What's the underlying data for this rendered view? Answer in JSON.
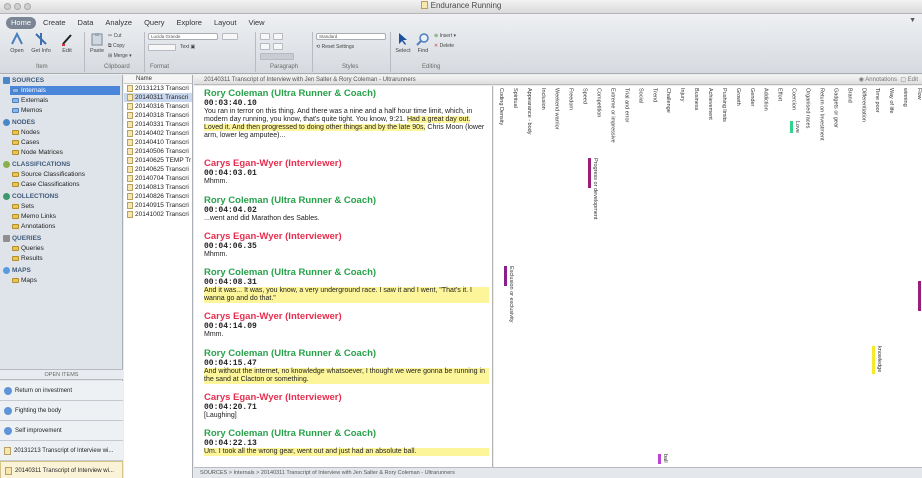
{
  "window": {
    "title": "Endurance Running"
  },
  "ribbon": {
    "tabs": [
      "Home",
      "Create",
      "Data",
      "Analyze",
      "Query",
      "Explore",
      "Layout",
      "View"
    ],
    "active_tab": "Home",
    "groups": [
      "Item",
      "Clipboard",
      "Format",
      "Paragraph",
      "Styles",
      "Editing"
    ],
    "buttons": {
      "open": "Open",
      "get_info": "Get Info",
      "edit": "Edit",
      "paste": "Paste",
      "cut": "Cut",
      "copy": "Copy",
      "merge": "Merge",
      "select": "Select",
      "find": "Find",
      "insert": "Insert",
      "delete": "Delete",
      "reset_settings": "Reset Settings",
      "text": "Text"
    },
    "font_field": "Lucida Grande",
    "style_field": "Standard"
  },
  "nav": {
    "sources": {
      "title": "SOURCES",
      "items": [
        "Internals",
        "Externals",
        "Memos"
      ]
    },
    "nodes": {
      "title": "NODES",
      "items": [
        "Nodes",
        "Cases",
        "Node Matrices"
      ]
    },
    "classifications": {
      "title": "CLASSIFICATIONS",
      "items": [
        "Source Classifications",
        "Case Classifications"
      ]
    },
    "collections": {
      "title": "COLLECTIONS",
      "items": [
        "Sets",
        "Memo Links",
        "Annotations"
      ]
    },
    "queries": {
      "title": "QUERIES",
      "items": [
        "Queries",
        "Results"
      ]
    },
    "maps": {
      "title": "MAPS",
      "items": [
        "Maps"
      ]
    },
    "open_items_title": "OPEN ITEMS",
    "open_items": [
      "Return on investment",
      "Fighting the body",
      "Self improvement",
      "20131213 Transcript of Interview wi...",
      "20140311 Transcript of Interview wi..."
    ]
  },
  "list": {
    "header": "Name",
    "rows": [
      "20131213 Transcri",
      "20140311 Transcri",
      "20140316 Transcri",
      "20140318 Transcri",
      "20140331 Transcri",
      "20140402 Transcri",
      "20140410 Transcri",
      "20140506 Transcri",
      "20140625 TEMP Tr",
      "20140625 Transcri",
      "20140704 Transcri",
      "20140813 Transcri",
      "20140826 Transcri",
      "20140915 Transcri",
      "20141002 Transcri"
    ],
    "selected_index": 1
  },
  "detail": {
    "tab_title": "20140311 Transcript of Interview with Jen Salter & Rory Coleman - Ultrarunners",
    "annotations_label": "Annotations",
    "edit_label": "Edit",
    "entries": [
      {
        "speaker": "Rory Coleman (Ultra Runner & Coach)",
        "time": "00:03:40.10",
        "text": "You ran in terror on this thing. And there was a nine and a half hour time limit, which, in modern day running, you know, that's quite tight. You know, 9:21.",
        "highlight": "Had a great day out. Loved it. And then progressed to doing other things and by the late 90s,",
        "after": "Chris Moon (lower arm, lower leg amputee)..."
      },
      {
        "speaker": "Carys Egan-Wyer (Interviewer)",
        "time": "00:04:03.01",
        "text": "Mhmm."
      },
      {
        "speaker": "Rory Coleman (Ultra Runner & Coach)",
        "time": "00:04:04.02",
        "text": "...went and did Marathon des Sables."
      },
      {
        "speaker": "Carys Egan-Wyer (Interviewer)",
        "time": "00:04:06.35",
        "text": "Mhmm."
      },
      {
        "speaker": "Rory Coleman (Ultra Runner & Coach)",
        "time": "00:04:08.31",
        "text": "And it was... It was, you know, a very underground race. I saw it and I went, \"That's it. I wanna go and do that.\""
      },
      {
        "speaker": "Carys Egan-Wyer (Interviewer)",
        "time": "00:04:14.09",
        "text": "Mmm."
      },
      {
        "speaker": "Rory Coleman (Ultra Runner & Coach)",
        "time": "00:04:15.47",
        "text": "And without the internet, no knowledge whatsoever, I thought we were gonna be running in the sand at Clacton or something."
      },
      {
        "speaker": "Carys Egan-Wyer (Interviewer)",
        "time": "00:04:20.71",
        "text": "[Laughing]"
      },
      {
        "speaker": "Rory Coleman (Ultra Runner & Coach)",
        "time": "00:04:22.13",
        "text": "Um. I took all the wrong gear, went out and just had an absolute ball."
      }
    ]
  },
  "stripes": {
    "labels": [
      "Coding Density",
      "Spiritual",
      "Appearance - body",
      "Inclusion",
      "Weekend warrior",
      "Freedom",
      "Speed",
      "Competition",
      "Extreme or impressive",
      "Trial and error",
      "Social",
      "Trend",
      "Challenge",
      "Injury",
      "Business",
      "Achievement",
      "Pushing limits",
      "Growth",
      "Gender",
      "Addiction",
      "Effort",
      "Coercion",
      "Organised races",
      "Return on Investment",
      "Gadgets or gear",
      "Brand",
      "Differentiation",
      "Time poor",
      "Way of life",
      "winning",
      "Flow"
    ],
    "coded": [
      {
        "label": "Progress or development",
        "color": "#9b1f7a"
      },
      {
        "label": "Love",
        "color": "#2fd48a"
      },
      {
        "label": "Exclusion or exclusivity",
        "color": "#8a1f8f"
      },
      {
        "label": "knowledge",
        "color": "#f4ea2a"
      },
      {
        "label": "ball",
        "color": "#c040d8"
      }
    ]
  },
  "statusbar": "SOURCES > Internals > 20140311 Transcript of Interview with Jen Salter & Rory Coleman - Ultrarunners"
}
